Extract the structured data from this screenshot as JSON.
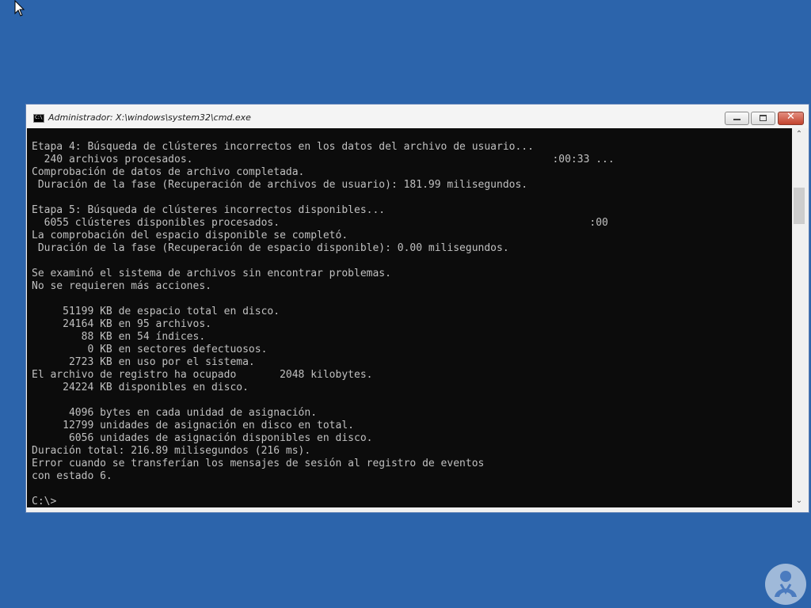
{
  "window": {
    "title": "Administrador: X:\\windows\\system32\\cmd.exe",
    "icon": "cmd-icon",
    "icon_text": "C:\\",
    "minimize_icon": "minimize-icon",
    "maximize_icon": "maximize-icon",
    "close_icon": "close-icon",
    "close_glyph": "✕"
  },
  "console": {
    "background": "#0c0c0c",
    "foreground": "#c0c0c0",
    "lines": [
      "Etapa 4: Búsqueda de clústeres incorrectos en los datos del archivo de usuario...",
      "  240 archivos procesados.                                                          :00:33 ...",
      "Comprobación de datos de archivo completada.",
      " Duración de la fase (Recuperación de archivos de usuario): 181.99 milisegundos.",
      "",
      "Etapa 5: Búsqueda de clústeres incorrectos disponibles...",
      "  6055 clústeres disponibles procesados.                                                  :00",
      "La comprobación del espacio disponible se completó.",
      " Duración de la fase (Recuperación de espacio disponible): 0.00 milisegundos.",
      "",
      "Se examinó el sistema de archivos sin encontrar problemas.",
      "No se requieren más acciones.",
      "",
      "     51199 KB de espacio total en disco.",
      "     24164 KB en 95 archivos.",
      "        88 KB en 54 índices.",
      "         0 KB en sectores defectuosos.",
      "      2723 KB en uso por el sistema.",
      "El archivo de registro ha ocupado       2048 kilobytes.",
      "     24224 KB disponibles en disco.",
      "",
      "      4096 bytes en cada unidad de asignación.",
      "     12799 unidades de asignación en disco en total.",
      "      6056 unidades de asignación disponibles en disco.",
      "Duración total: 216.89 milisegundos (216 ms).",
      "Error cuando se transferían los mensajes de sesión al registro de eventos",
      "con estado 6.",
      "",
      "C:\\>"
    ]
  },
  "scrollbar": {
    "up_icon": "scroll-up-arrow-icon",
    "down_icon": "scroll-down-arrow-icon",
    "up_glyph": "⌃",
    "down_glyph": "⌄"
  },
  "desktop": {
    "background": "#2c64ab",
    "watermark_icon": "person-logo-icon"
  }
}
